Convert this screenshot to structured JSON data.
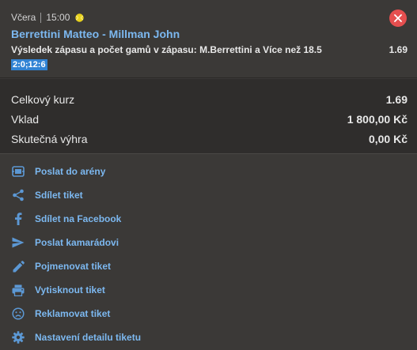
{
  "bet": {
    "day": "Včera",
    "time": "15:00",
    "sport_icon": "tennis-ball-icon",
    "event": "Berrettini Matteo - Millman John",
    "market": "Výsledek zápasu a počet gamů v zápasu: M.Berrettini a Více než 18.5",
    "odds": "1.69",
    "score": "2:0;12:6",
    "close_icon": "close-icon"
  },
  "summary": {
    "total_odds_label": "Celkový kurz",
    "total_odds_value": "1.69",
    "stake_label": "Vklad",
    "stake_value": "1 800,00 Kč",
    "payout_label": "Skutečná výhra",
    "payout_value": "0,00 Kč"
  },
  "actions": [
    {
      "label": "Poslat do arény",
      "icon": "arena-icon"
    },
    {
      "label": "Sdílet tiket",
      "icon": "share-icon"
    },
    {
      "label": "Sdílet na Facebook",
      "icon": "facebook-icon"
    },
    {
      "label": "Poslat kamarádovi",
      "icon": "send-icon"
    },
    {
      "label": "Pojmenovat tiket",
      "icon": "pencil-icon"
    },
    {
      "label": "Vytisknout tiket",
      "icon": "printer-icon"
    },
    {
      "label": "Reklamovat tiket",
      "icon": "sad-face-icon"
    },
    {
      "label": "Nastavení detailu tiketu",
      "icon": "gear-icon"
    }
  ],
  "colors": {
    "accent_blue": "#7cb8f0",
    "icon_blue": "#5c98d4",
    "close_red": "#e54f4f",
    "badge_blue": "#3183d4",
    "ball_yellow": "#e8d21d"
  }
}
